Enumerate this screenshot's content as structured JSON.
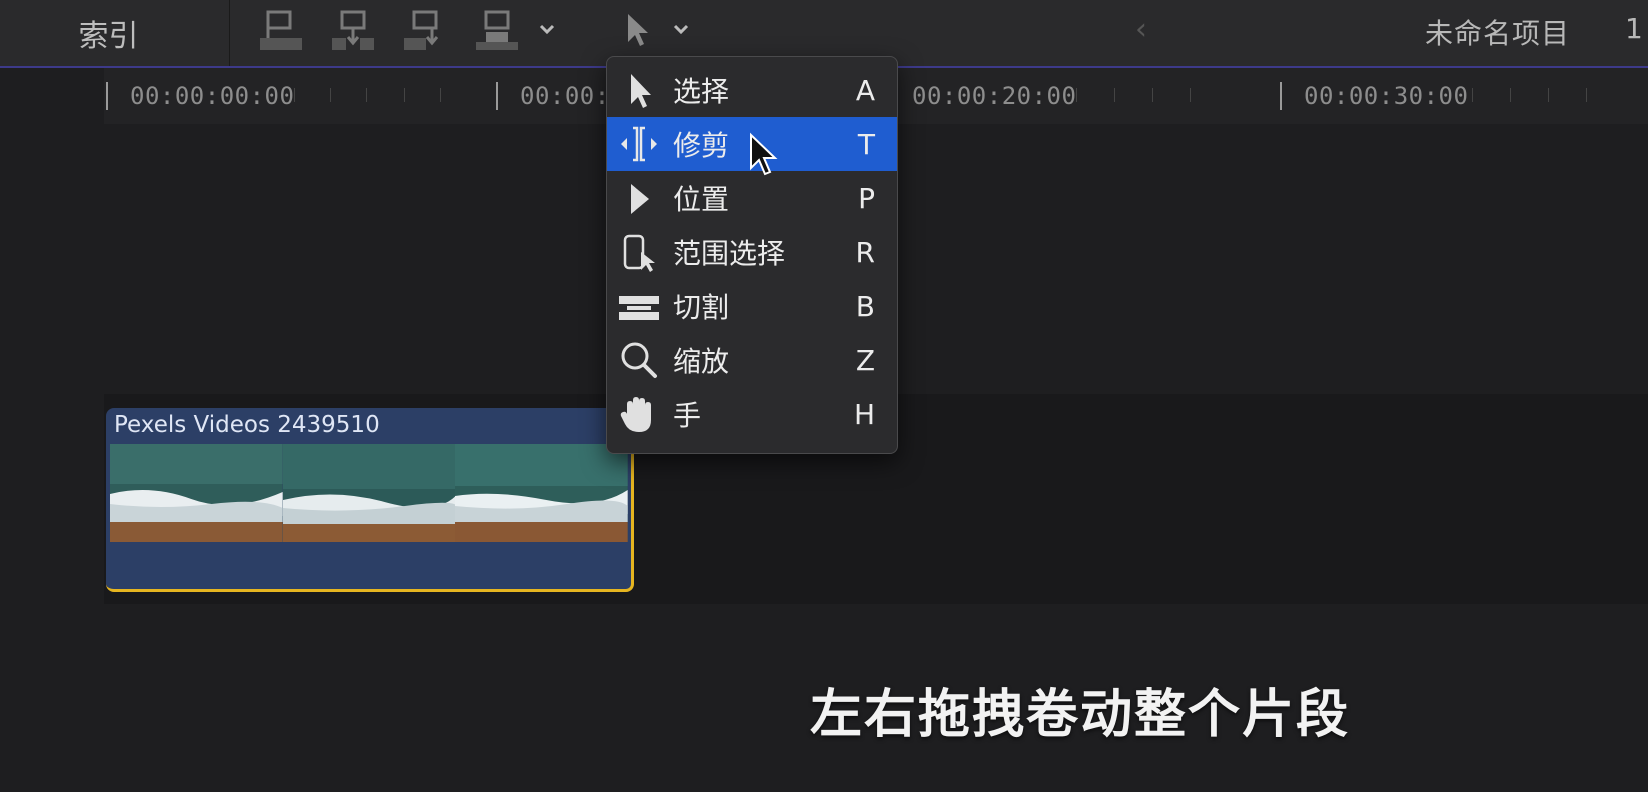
{
  "toolbar": {
    "index_label": "索引",
    "project_title": "未命名项目",
    "project_extra": "1",
    "icons": [
      "connect-clip-icon",
      "insert-clip-icon",
      "append-clip-icon",
      "overwrite-clip-icon",
      "select-tool-icon"
    ]
  },
  "ruler": {
    "timecodes": [
      "00:00:00:00",
      "00:00:",
      "00:00:20:00",
      "00:00:30:00"
    ]
  },
  "clip": {
    "title": "Pexels Videos 2439510"
  },
  "tool_menu": {
    "items": [
      {
        "label": "选择",
        "key": "A",
        "icon": "arrow-icon"
      },
      {
        "label": "修剪",
        "key": "T",
        "icon": "trim-icon",
        "active": true
      },
      {
        "label": "位置",
        "key": "P",
        "icon": "position-icon"
      },
      {
        "label": "范围选择",
        "key": "R",
        "icon": "range-select-icon"
      },
      {
        "label": "切割",
        "key": "B",
        "icon": "blade-icon"
      },
      {
        "label": "缩放",
        "key": "Z",
        "icon": "zoom-icon"
      },
      {
        "label": "手",
        "key": "H",
        "icon": "hand-icon"
      }
    ]
  },
  "subtitle": "左右拖拽卷动整个片段",
  "colors": {
    "accent_active": "#1f5dd0",
    "clip_bg": "#2c3f66",
    "clip_trim_edge": "#e6b520",
    "toolbar_border": "#3d3a8a"
  }
}
